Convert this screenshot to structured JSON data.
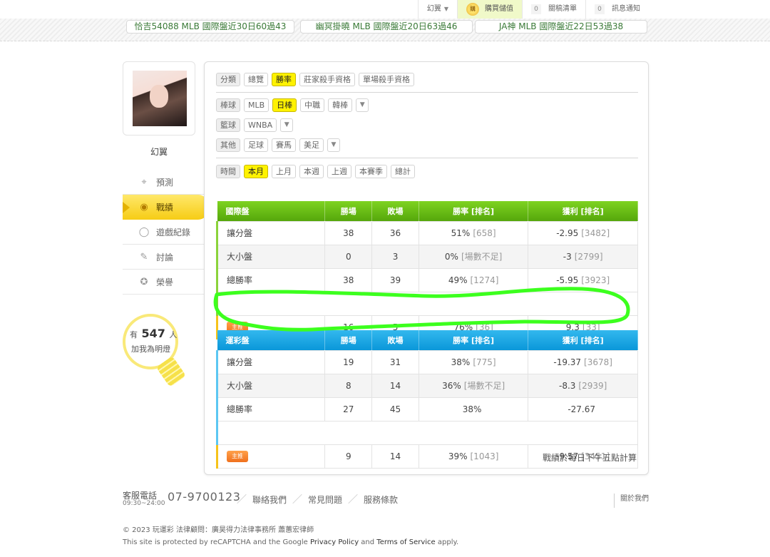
{
  "topbar": {
    "user_menu": "幻翼",
    "buy_label": "購買儲值",
    "buy_icon_text": "購",
    "watchlist": {
      "count": "0",
      "label": "關稿清單"
    },
    "messages": {
      "count": "0",
      "label": "訊息通知"
    }
  },
  "marquee": [
    "恰吉54088  MLB  國際盤近30日60過43",
    "幽冥掛曉  MLB  國際盤近20日63過46",
    "JA神  MLB  國際盤近22日53過38"
  ],
  "profile": {
    "name": "幻翼"
  },
  "side_nav": [
    {
      "label": "預測",
      "icon": "crosshair-icon"
    },
    {
      "label": "戰績",
      "icon": "trophy-icon"
    },
    {
      "label": "遊戲紀錄",
      "icon": "record-icon"
    },
    {
      "label": "討論",
      "icon": "discussion-icon"
    },
    {
      "label": "榮譽",
      "icon": "medal-icon"
    }
  ],
  "fans": {
    "prefix": "有",
    "count": "547",
    "suffix": "人",
    "line2": "加我為明燈"
  },
  "filters": {
    "category": {
      "label": "分類",
      "options": [
        "總覽",
        "勝率",
        "莊家殺手資格",
        "單場殺手資格"
      ],
      "selected": "勝率"
    },
    "baseball": {
      "label": "棒球",
      "options": [
        "MLB",
        "日棒",
        "中職",
        "韓棒"
      ],
      "selected": "日棒"
    },
    "basketball": {
      "label": "籃球",
      "options": [
        "WNBA"
      ]
    },
    "other": {
      "label": "其他",
      "options": [
        "足球",
        "賽馬",
        "美足"
      ]
    },
    "time": {
      "label": "時間",
      "options": [
        "本月",
        "上月",
        "本週",
        "上週",
        "本賽季",
        "總計"
      ],
      "selected": "本月"
    }
  },
  "table_intl": {
    "headers": [
      "國際盤",
      "勝場",
      "敗場",
      "勝率 [排名]",
      "獲利 [排名]"
    ],
    "rows": [
      {
        "name": "讓分盤",
        "win": "38",
        "loss": "36",
        "rate": "51%",
        "rate_rank": "[658]",
        "profit": "-2.95",
        "profit_rank": "[3482]"
      },
      {
        "name": "大小盤",
        "win": "0",
        "loss": "3",
        "rate": "0%",
        "rate_rank": "[場數不足]",
        "profit": "-3",
        "profit_rank": "[2799]"
      },
      {
        "name": "總勝率",
        "win": "38",
        "loss": "39",
        "rate": "49%",
        "rate_rank": "[1274]",
        "profit": "-5.95",
        "profit_rank": "[3923]"
      }
    ],
    "main": {
      "tag": "主推",
      "win": "16",
      "loss": "5",
      "rate": "76%",
      "rate_rank": "[36]",
      "profit": "9.3",
      "profit_rank": "[33]"
    }
  },
  "table_lottery": {
    "headers": [
      "運彩盤",
      "勝場",
      "敗場",
      "勝率 [排名]",
      "獲利 [排名]"
    ],
    "rows": [
      {
        "name": "讓分盤",
        "win": "19",
        "loss": "31",
        "rate": "38%",
        "rate_rank": "[775]",
        "profit": "-19.37",
        "profit_rank": "[3678]"
      },
      {
        "name": "大小盤",
        "win": "8",
        "loss": "14",
        "rate": "36%",
        "rate_rank": "[場數不足]",
        "profit": "-8.3",
        "profit_rank": "[2939]"
      },
      {
        "name": "總勝率",
        "win": "27",
        "loss": "45",
        "rate": "38%",
        "rate_rank": "",
        "profit": "-27.67",
        "profit_rank": ""
      }
    ],
    "main": {
      "tag": "主推",
      "win": "9",
      "loss": "14",
      "rate": "39%",
      "rate_rank": "[1043]",
      "profit": "-9.57",
      "profit_rank": "[3451]"
    }
  },
  "note": "戰績於每日下午五點計算",
  "footer": {
    "service_label": "客服電話",
    "hours": "09:30~24:00",
    "phone": "07-9700123",
    "links": [
      "聯絡我們",
      "常見問題",
      "服務條款"
    ],
    "about": "關於我們",
    "copyright": "© 2023 玩運彩 法律顧問：廣昊得力法律事務所 蕭蕙宏律師",
    "recaptcha_pre": "This site is protected by reCAPTCHA and the Google ",
    "privacy": "Privacy Policy",
    "and": " and ",
    "terms": "Terms of Service",
    "apply": " apply."
  },
  "colors": {
    "highlight": "#3cff1e",
    "green_header": "#6cc417",
    "blue_header": "#1aa7e4",
    "selected_chip": "#fff200"
  }
}
